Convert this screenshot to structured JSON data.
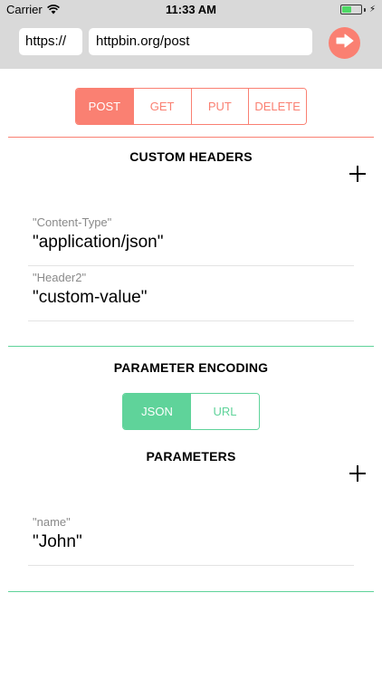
{
  "status_bar": {
    "carrier": "Carrier",
    "time": "11:33 AM",
    "battery_level": 0.5
  },
  "request_bar": {
    "scheme": "https://",
    "url": "httpbin.org/post",
    "send_icon": "arrow-right-circle"
  },
  "methods": {
    "options": [
      "POST",
      "GET",
      "PUT",
      "DELETE"
    ],
    "selected": "POST",
    "accent_color": "#fa8072"
  },
  "custom_headers": {
    "title": "CUSTOM HEADERS",
    "add_icon": "plus",
    "items": [
      {
        "key": "\"Content-Type\"",
        "value": "\"application/json\""
      },
      {
        "key": "\"Header2\"",
        "value": "\"custom-value\""
      }
    ]
  },
  "parameter_encoding": {
    "title": "PARAMETER ENCODING",
    "options": [
      "JSON",
      "URL"
    ],
    "selected": "JSON",
    "accent_color": "#5fd39a"
  },
  "parameters": {
    "title": "PARAMETERS",
    "add_icon": "plus",
    "items": [
      {
        "key": "\"name\"",
        "value": "\"John\""
      }
    ]
  }
}
